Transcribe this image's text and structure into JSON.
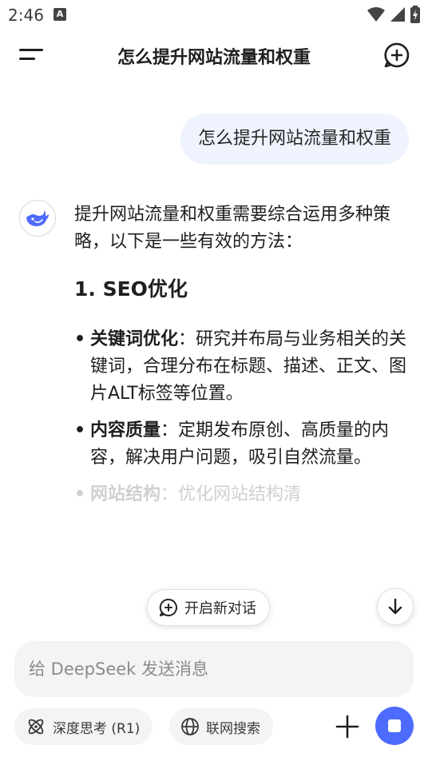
{
  "status_bar": {
    "time": "2:46",
    "notification_letter": "A"
  },
  "header": {
    "title": "怎么提升网站流量和权重"
  },
  "user_message": "怎么提升网站流量和权重",
  "assistant": {
    "intro": "提升网站流量和权重需要综合运用多种策略，以下是一些有效的方法：",
    "section_heading": "1. SEO优化",
    "bullets": [
      {
        "title": "关键词优化",
        "text": "：研究并布局与业务相关的关键词，合理分布在标题、描述、正文、图片ALT标签等位置。"
      },
      {
        "title": "内容质量",
        "text": "：定期发布原创、高质量的内容，解决用户问题，吸引自然流量。"
      },
      {
        "title": "网站结构",
        "text": "：优化网站结构清"
      }
    ]
  },
  "floating": {
    "new_chat_label": "开启新对话"
  },
  "input": {
    "placeholder": "给 DeepSeek 发送消息"
  },
  "toolbar": {
    "deep_think_label": "深度思考 (R1)",
    "web_search_label": "联网搜索"
  },
  "colors": {
    "accent": "#4d6bfe",
    "bubble": "#eef3fd",
    "input_bg": "#f3f4f6"
  }
}
